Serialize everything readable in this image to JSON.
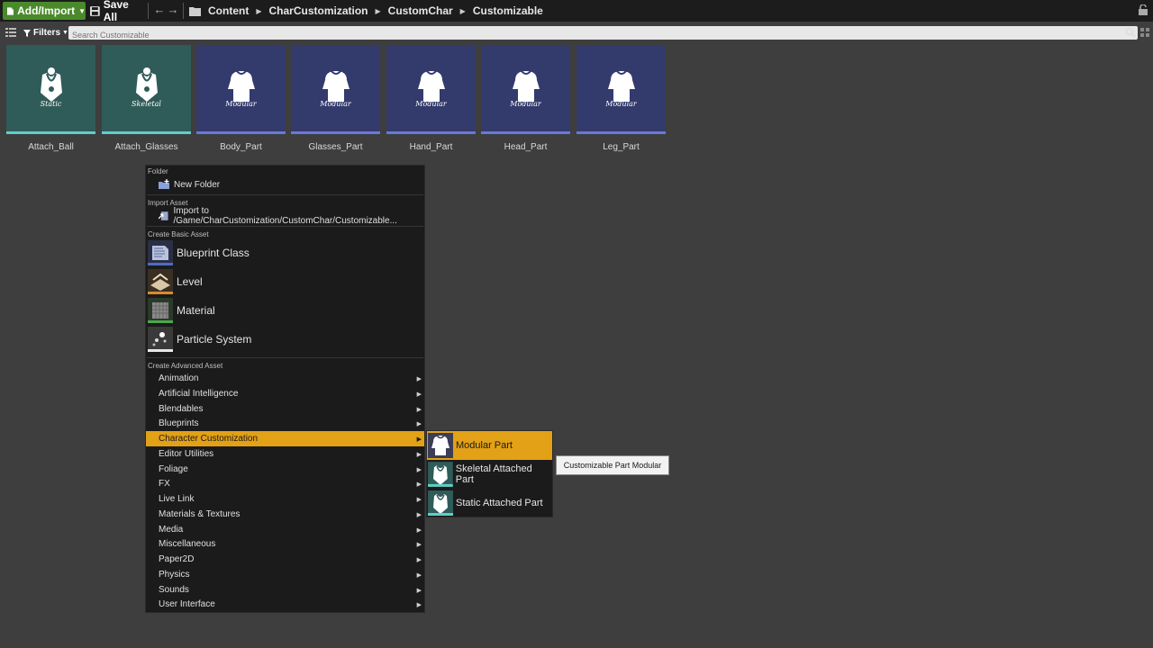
{
  "toolbar": {
    "add_import_label": "Add/Import",
    "save_all_label": "Save All",
    "breadcrumbs": [
      "Content",
      "CharCustomization",
      "CustomChar",
      "Customizable"
    ]
  },
  "filterbar": {
    "filters_label": "Filters",
    "search_placeholder": "Search Customizable"
  },
  "assets": [
    {
      "name": "Attach_Ball",
      "subtitle": "Static",
      "kind": "attached"
    },
    {
      "name": "Attach_Glasses",
      "subtitle": "Skeletal",
      "kind": "attached"
    },
    {
      "name": "Body_Part",
      "subtitle": "Modular",
      "kind": "modular"
    },
    {
      "name": "Glasses_Part",
      "subtitle": "Modular",
      "kind": "modular"
    },
    {
      "name": "Hand_Part",
      "subtitle": "Modular",
      "kind": "modular"
    },
    {
      "name": "Head_Part",
      "subtitle": "Modular",
      "kind": "modular"
    },
    {
      "name": "Leg_Part",
      "subtitle": "Modular",
      "kind": "modular"
    }
  ],
  "context_menu": {
    "folder_header": "Folder",
    "new_folder_label": "New Folder",
    "import_header": "Import Asset",
    "import_label": "Import to /Game/CharCustomization/CustomChar/Customizable...",
    "basic_header": "Create Basic Asset",
    "basic_items": [
      "Blueprint Class",
      "Level",
      "Material",
      "Particle System"
    ],
    "advanced_header": "Create Advanced Asset",
    "advanced_items": [
      "Animation",
      "Artificial Intelligence",
      "Blendables",
      "Blueprints",
      "Character Customization",
      "Editor Utilities",
      "Foliage",
      "FX",
      "Live Link",
      "Materials & Textures",
      "Media",
      "Miscellaneous",
      "Paper2D",
      "Physics",
      "Sounds",
      "User Interface"
    ],
    "active_item": "Character Customization"
  },
  "submenu": {
    "items": [
      "Modular Part",
      "Skeletal Attached  Part",
      "Static Attached Part"
    ],
    "active_item": "Modular Part"
  },
  "tooltip": "Customizable Part Modular",
  "colors": {
    "accent_green": "#4a8a2c",
    "highlight": "#e2a116",
    "teal_tile": "#2f5b58",
    "navy_tile": "#333a6c"
  }
}
